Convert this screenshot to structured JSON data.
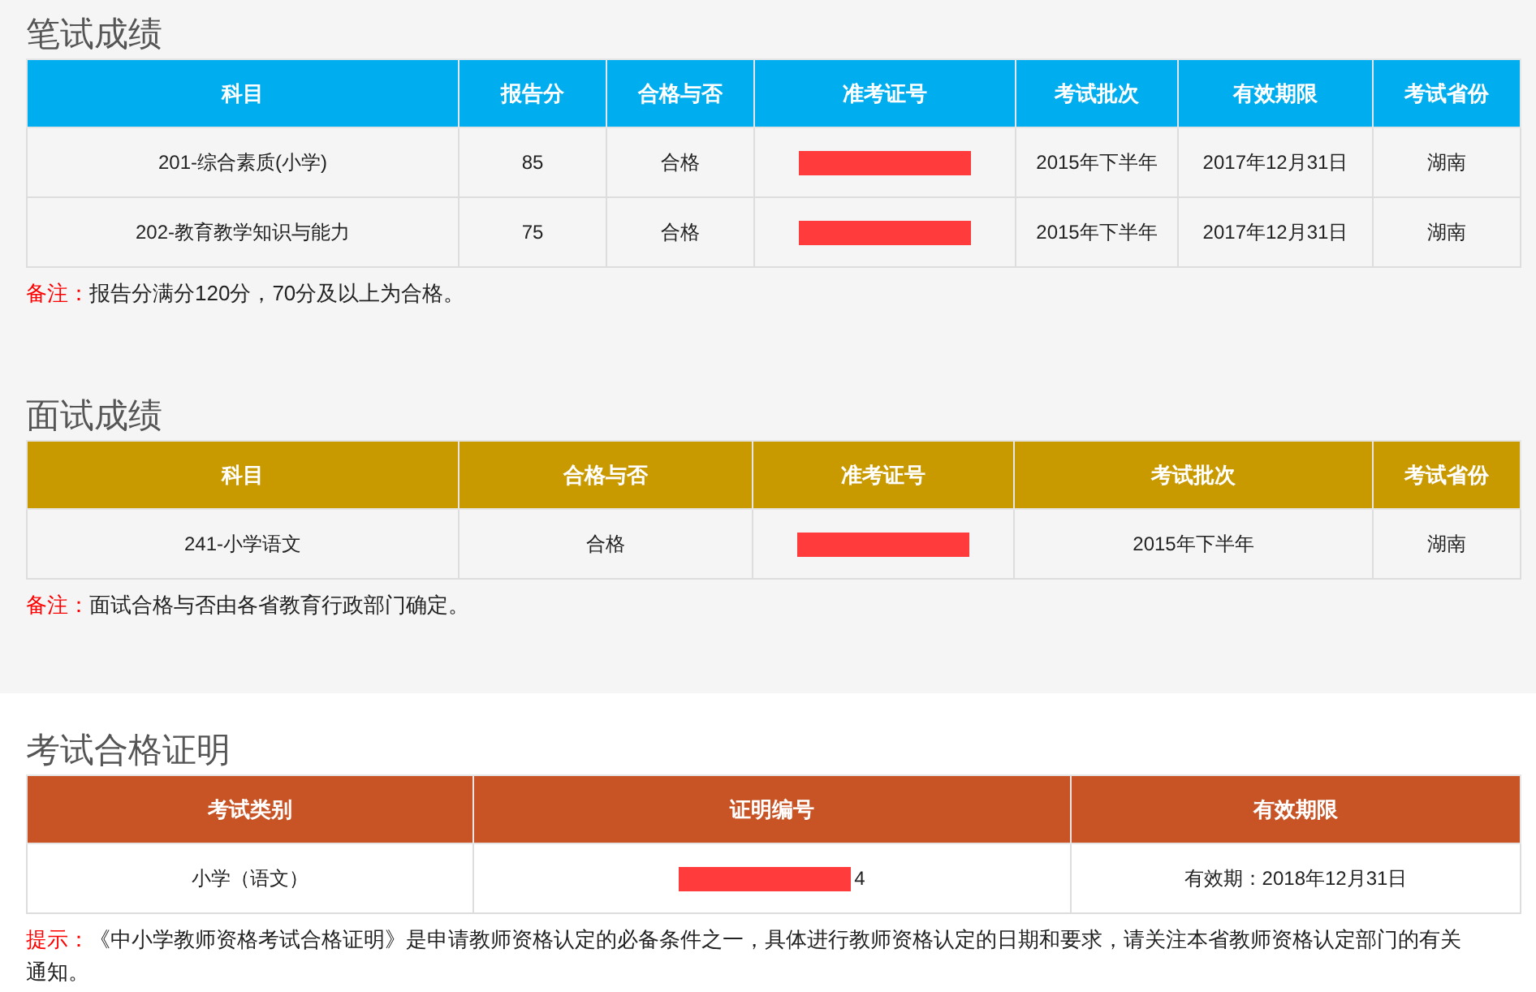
{
  "sections": [
    {
      "title": "笔试成绩",
      "color": "#00aeef",
      "columns": [
        "科目",
        "报告分",
        "合格与否",
        "准考证号",
        "考试批次",
        "有效期限",
        "考试省份"
      ],
      "rows": [
        [
          {
            "text": "201-综合素质(小学)"
          },
          {
            "text": "85"
          },
          {
            "text": "合格"
          },
          {
            "kind": "redacted"
          },
          {
            "text": "2015年下半年"
          },
          {
            "text": "2017年12月31日"
          },
          {
            "text": "湖南"
          }
        ],
        [
          {
            "text": "202-教育教学知识与能力"
          },
          {
            "text": "75"
          },
          {
            "text": "合格"
          },
          {
            "kind": "redacted"
          },
          {
            "text": "2015年下半年"
          },
          {
            "text": "2017年12月31日"
          },
          {
            "text": "湖南"
          }
        ]
      ],
      "note": {
        "label": "备注：",
        "text": "报告分满分120分，70分及以上为合格。"
      }
    },
    {
      "title": "面试成绩",
      "color": "#c99a00",
      "columns": [
        "科目",
        "合格与否",
        "准考证号",
        "考试批次",
        "考试省份"
      ],
      "rows": [
        [
          {
            "text": "241-小学语文"
          },
          {
            "text": "合格"
          },
          {
            "kind": "redacted"
          },
          {
            "text": "2015年下半年"
          },
          {
            "text": "湖南"
          }
        ]
      ],
      "note": {
        "label": "备注：",
        "text": "面试合格与否由各省教育行政部门确定。"
      }
    },
    {
      "title": "考试合格证明",
      "color": "#c85426",
      "columns": [
        "考试类别",
        "证明编号",
        "有效期限"
      ],
      "rows": [
        [
          {
            "text": "小学（语文）"
          },
          {
            "kind": "redacted",
            "text": "4"
          },
          {
            "text": "有效期：2018年12月31日"
          }
        ]
      ],
      "note": {
        "label": "提示：",
        "text": "《中小学教师资格考试合格证明》是申请教师资格认定的必备条件之一，具体进行教师资格认定的日期和要求，请关注本省教师资格认定部门的有关通知。"
      }
    }
  ]
}
